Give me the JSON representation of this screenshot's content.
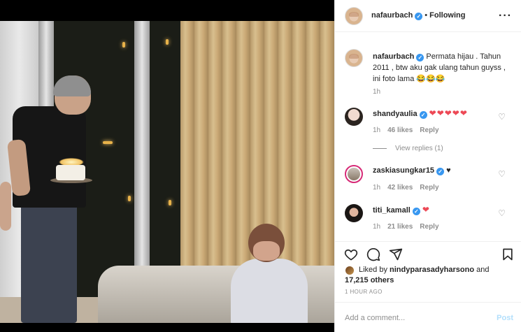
{
  "post": {
    "username": "nafaurbach",
    "follow_label": "Following",
    "more_label": "···",
    "caption_text": "Permata hijau . Tahun 2011 , btw aku gak ulang tahun guyss , ini foto lama 😂😂😂",
    "caption_time": "1h"
  },
  "comments": [
    {
      "username": "shandyaulia",
      "text": "❤❤❤❤❤",
      "time": "1h",
      "likes": "46 likes",
      "reply": "Reply",
      "view_replies": "View replies (1)"
    },
    {
      "username": "zaskiasungkar15",
      "text": "♥",
      "time": "1h",
      "likes": "42 likes",
      "reply": "Reply"
    },
    {
      "username": "titi_kamall",
      "text": "❤",
      "time": "1h",
      "likes": "21 likes",
      "reply": "Reply"
    }
  ],
  "likes": {
    "prefix": "Liked by ",
    "liker": "nindyparasadyharsono",
    "and": " and",
    "count": "17,215 others"
  },
  "timestamp": "1 HOUR AGO",
  "add_comment": {
    "placeholder": "Add a comment...",
    "post_label": "Post"
  },
  "icons": [
    "verified-badge-icon",
    "more-options-icon",
    "heart-icon",
    "comment-icon",
    "share-icon",
    "bookmark-icon"
  ],
  "colors": {
    "verified": "#3897f0",
    "heart": "#ed4956",
    "post_disabled": "#b2dffc",
    "meta": "#8e8e8e"
  }
}
